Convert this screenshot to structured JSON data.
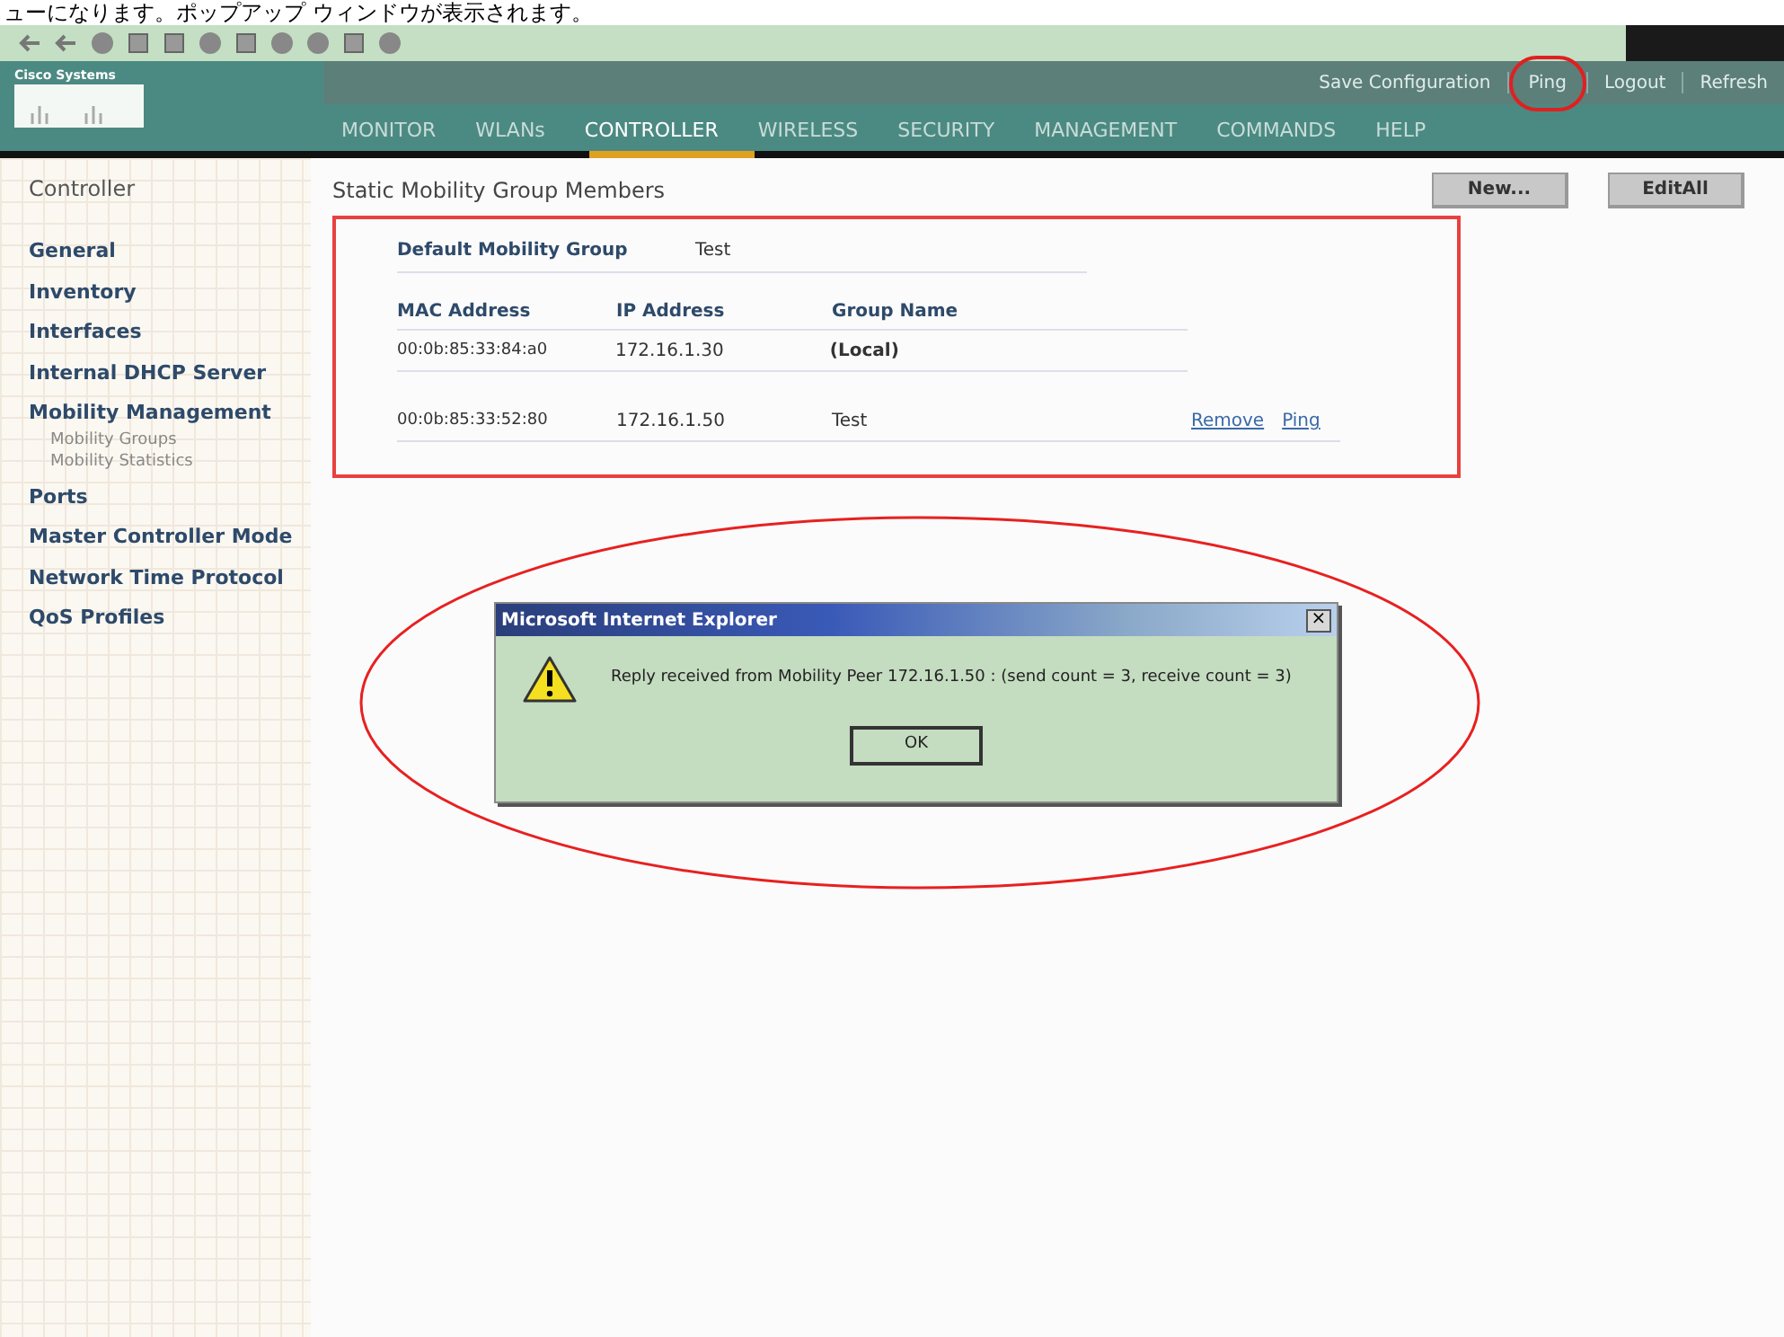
{
  "caption": "ューになります。ポップアップ ウィンドウが表示されます。",
  "header": {
    "brand": "Cisco Systems",
    "links": [
      {
        "label": "Save Configuration",
        "circled": false
      },
      {
        "label": "Ping",
        "circled": true
      },
      {
        "label": "Logout",
        "circled": false
      },
      {
        "label": "Refresh",
        "circled": false
      }
    ],
    "menu": [
      {
        "label": "MONITOR",
        "selected": false
      },
      {
        "label": "WLANs",
        "selected": false
      },
      {
        "label": "CONTROLLER",
        "selected": true
      },
      {
        "label": "WIRELESS",
        "selected": false
      },
      {
        "label": "SECURITY",
        "selected": false
      },
      {
        "label": "MANAGEMENT",
        "selected": false
      },
      {
        "label": "COMMANDS",
        "selected": false
      },
      {
        "label": "HELP",
        "selected": false
      }
    ]
  },
  "sidebar": {
    "title": "Controller",
    "items": [
      {
        "label": "General"
      },
      {
        "label": "Inventory"
      },
      {
        "label": "Interfaces"
      },
      {
        "label": "Internal DHCP Server"
      },
      {
        "label": "Mobility Management",
        "children": [
          {
            "label": "Mobility Groups"
          },
          {
            "label": "Mobility Statistics"
          }
        ]
      },
      {
        "label": "Ports"
      },
      {
        "label": "Master Controller Mode"
      },
      {
        "label": "Network Time Protocol"
      },
      {
        "label": "QoS Profiles"
      }
    ]
  },
  "page": {
    "title": "Static Mobility Group Members",
    "buttons": [
      "New...",
      "EditAll"
    ],
    "default_group_label": "Default Mobility Group",
    "default_group_value": "Test",
    "table": {
      "columns": [
        "MAC Address",
        "IP Address",
        "Group Name"
      ],
      "rows": [
        {
          "mac": "00:0b:85:33:84:a0",
          "ip": "172.16.1.30",
          "group": "(Local)",
          "actions": []
        },
        {
          "mac": "00:0b:85:33:52:80",
          "ip": "172.16.1.50",
          "group": "Test",
          "actions": [
            "Remove",
            "Ping"
          ]
        }
      ]
    }
  },
  "dialog": {
    "title": "Microsoft Internet Explorer",
    "close": "×",
    "message": "Reply received from Mobility Peer 172.16.1.50 : (send count = 3, receive count = 3)",
    "button": "OK"
  }
}
